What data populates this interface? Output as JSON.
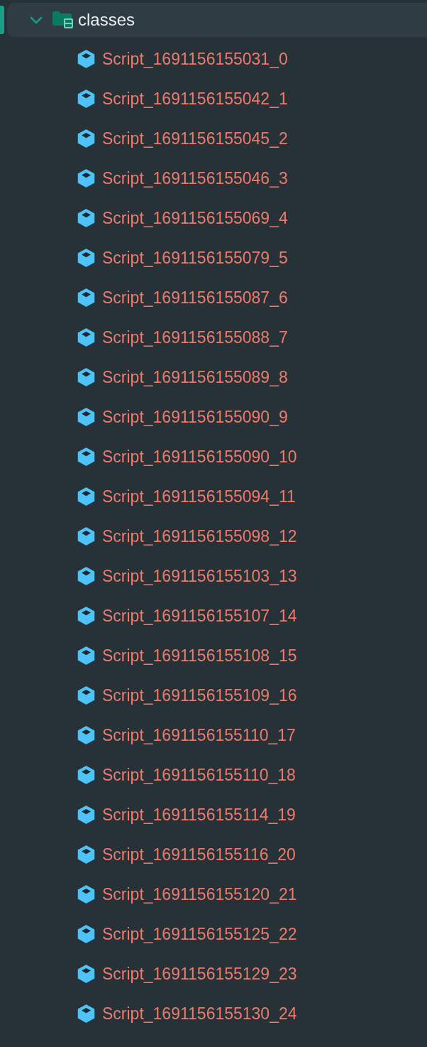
{
  "tree": {
    "label": "classes",
    "expanded": true,
    "selected": true,
    "children": [
      {
        "label": "Script_1691156155031_0",
        "selected": false
      },
      {
        "label": "Script_1691156155042_1",
        "selected": false
      },
      {
        "label": "Script_1691156155045_2",
        "selected": false
      },
      {
        "label": "Script_1691156155046_3",
        "selected": false
      },
      {
        "label": "Script_1691156155069_4",
        "selected": false
      },
      {
        "label": "Script_1691156155079_5",
        "selected": false
      },
      {
        "label": "Script_1691156155087_6",
        "selected": false
      },
      {
        "label": "Script_1691156155088_7",
        "selected": false
      },
      {
        "label": "Script_1691156155089_8",
        "selected": false
      },
      {
        "label": "Script_1691156155090_9",
        "selected": false
      },
      {
        "label": "Script_1691156155090_10",
        "selected": false
      },
      {
        "label": "Script_1691156155094_11",
        "selected": false
      },
      {
        "label": "Script_1691156155098_12",
        "selected": false
      },
      {
        "label": "Script_1691156155103_13",
        "selected": false
      },
      {
        "label": "Script_1691156155107_14",
        "selected": false
      },
      {
        "label": "Script_1691156155108_15",
        "selected": false
      },
      {
        "label": "Script_1691156155109_16",
        "selected": false
      },
      {
        "label": "Script_1691156155110_17",
        "selected": false
      },
      {
        "label": "Script_1691156155110_18",
        "selected": false
      },
      {
        "label": "Script_1691156155114_19",
        "selected": false
      },
      {
        "label": "Script_1691156155116_20",
        "selected": false
      },
      {
        "label": "Script_1691156155120_21",
        "selected": false
      },
      {
        "label": "Script_1691156155125_22",
        "selected": false
      },
      {
        "label": "Script_1691156155129_23",
        "selected": false
      },
      {
        "label": "Script_1691156155130_24",
        "selected": false
      }
    ]
  }
}
